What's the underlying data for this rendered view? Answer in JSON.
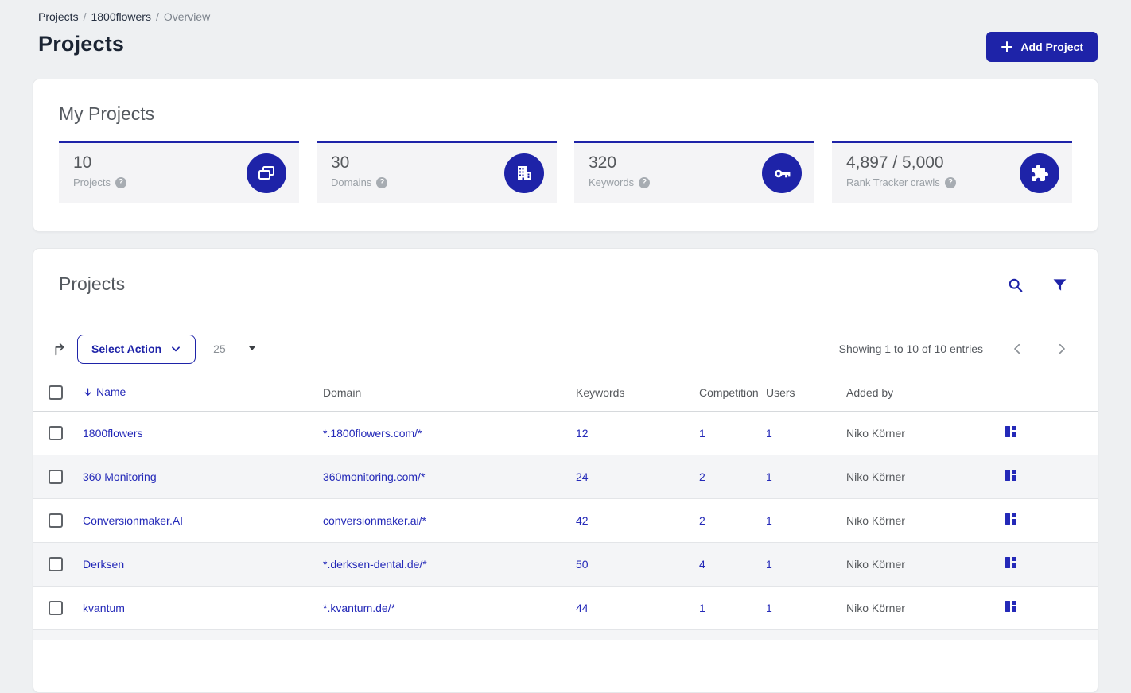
{
  "colors": {
    "brand_blue": "#1e23a8",
    "link_blue": "#2429b8",
    "page_background": "#eef0f2",
    "stat_card_background": "#f4f4f6",
    "text_gray": "#55585c"
  },
  "breadcrumb": {
    "separator": "/",
    "items": [
      "Projects",
      "1800flowers",
      "Overview"
    ]
  },
  "page": {
    "title": "Projects"
  },
  "header": {
    "add_project_label": "Add Project"
  },
  "my_projects": {
    "title": "My Projects",
    "cards": [
      {
        "value": "10",
        "label": "Projects",
        "icon": "projects-copy-icon"
      },
      {
        "value": "30",
        "label": "Domains",
        "icon": "building-icon"
      },
      {
        "value": "320",
        "label": "Keywords",
        "icon": "key-icon"
      },
      {
        "value": "4,897 / 5,000",
        "label": "Rank Tracker crawls",
        "icon": "puzzle-icon"
      }
    ]
  },
  "projects_panel": {
    "title": "Projects",
    "toolbar": {
      "select_action_label": "Select Action",
      "page_size": "25",
      "entries_info": "Showing 1 to 10 of 10 entries"
    },
    "table": {
      "columns": {
        "name": "Name",
        "domain": "Domain",
        "keywords": "Keywords",
        "competition": "Competition",
        "users": "Users",
        "added_by": "Added by"
      },
      "rows": [
        {
          "name": "1800flowers",
          "domain": "*.1800flowers.com/*",
          "keywords": "12",
          "competition": "1",
          "users": "1",
          "added_by": "Niko Körner"
        },
        {
          "name": "360 Monitoring",
          "domain": "360monitoring.com/*",
          "keywords": "24",
          "competition": "2",
          "users": "1",
          "added_by": "Niko Körner"
        },
        {
          "name": "Conversionmaker.AI",
          "domain": "conversionmaker.ai/*",
          "keywords": "42",
          "competition": "2",
          "users": "1",
          "added_by": "Niko Körner"
        },
        {
          "name": "Derksen",
          "domain": "*.derksen-dental.de/*",
          "keywords": "50",
          "competition": "4",
          "users": "1",
          "added_by": "Niko Körner"
        },
        {
          "name": "kvantum",
          "domain": "*.kvantum.de/*",
          "keywords": "44",
          "competition": "1",
          "users": "1",
          "added_by": "Niko Körner"
        }
      ]
    }
  }
}
